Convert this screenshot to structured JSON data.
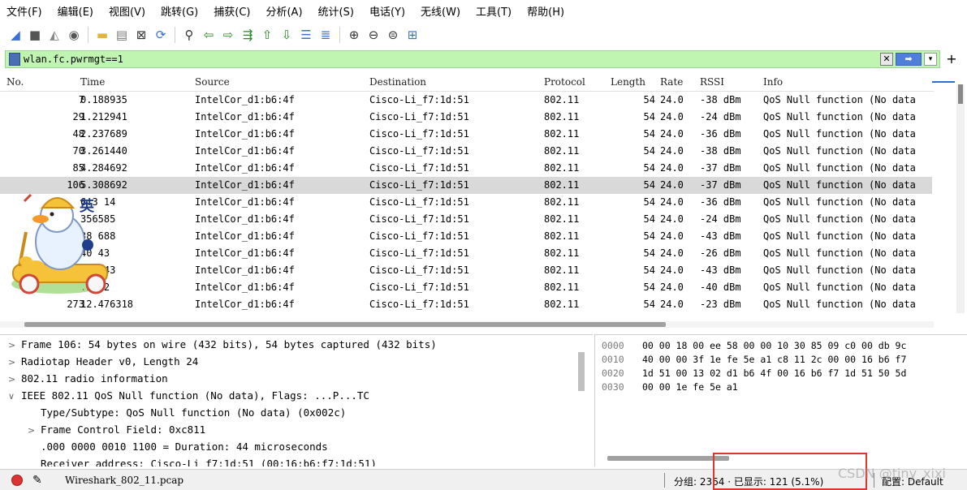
{
  "menu": [
    "文件(F)",
    "编辑(E)",
    "视图(V)",
    "跳转(G)",
    "捕获(C)",
    "分析(A)",
    "统计(S)",
    "电话(Y)",
    "无线(W)",
    "工具(T)",
    "帮助(H)"
  ],
  "toolbar_icons": [
    "shark-fin-start-icon",
    "stop-square-icon",
    "restart-fin-icon",
    "options-gear-icon",
    "open-folder-icon",
    "save-file-icon",
    "close-file-icon",
    "reload-icon",
    "find-magnifier-icon",
    "go-back-icon",
    "go-forward-icon",
    "go-to-packet-icon",
    "first-packet-icon",
    "last-packet-icon",
    "autoscroll-icon",
    "colorize-icon",
    "zoom-in-icon",
    "zoom-out-icon",
    "zoom-normal-icon",
    "resize-columns-icon"
  ],
  "filter": {
    "value": "wlan.fc.pwrmgt==1",
    "add_label": "+"
  },
  "columns": [
    "No.",
    "Time",
    "Source",
    "Destination",
    "Protocol",
    "Length",
    "Rate",
    "RSSI",
    "Info"
  ],
  "packets": [
    {
      "no": "7",
      "time": "0.188935",
      "src": "IntelCor_d1:b6:4f",
      "dst": "Cisco-Li_f7:1d:51",
      "proto": "802.11",
      "len": "54",
      "rate": "24.0",
      "rssi": "-38 dBm",
      "info": "QoS Null function (No data"
    },
    {
      "no": "29",
      "time": "1.212941",
      "src": "IntelCor_d1:b6:4f",
      "dst": "Cisco-Li_f7:1d:51",
      "proto": "802.11",
      "len": "54",
      "rate": "24.0",
      "rssi": "-24 dBm",
      "info": "QoS Null function (No data"
    },
    {
      "no": "48",
      "time": "2.237689",
      "src": "IntelCor_d1:b6:4f",
      "dst": "Cisco-Li_f7:1d:51",
      "proto": "802.11",
      "len": "54",
      "rate": "24.0",
      "rssi": "-36 dBm",
      "info": "QoS Null function (No data"
    },
    {
      "no": "70",
      "time": "3.261440",
      "src": "IntelCor_d1:b6:4f",
      "dst": "Cisco-Li_f7:1d:51",
      "proto": "802.11",
      "len": "54",
      "rate": "24.0",
      "rssi": "-38 dBm",
      "info": "QoS Null function (No data"
    },
    {
      "no": "85",
      "time": "4.284692",
      "src": "IntelCor_d1:b6:4f",
      "dst": "Cisco-Li_f7:1d:51",
      "proto": "802.11",
      "len": "54",
      "rate": "24.0",
      "rssi": "-37 dBm",
      "info": "QoS Null function (No data"
    },
    {
      "no": "106",
      "time": "5.308692",
      "src": "IntelCor_d1:b6:4f",
      "dst": "Cisco-Li_f7:1d:51",
      "proto": "802.11",
      "len": "54",
      "rate": "24.0",
      "rssi": "-37 dBm",
      "info": "QoS Null function (No data"
    },
    {
      "no": "",
      "time": "6.3  14",
      "src": "IntelCor_d1:b6:4f",
      "dst": "Cisco-Li_f7:1d:51",
      "proto": "802.11",
      "len": "54",
      "rate": "24.0",
      "rssi": "-36 dBm",
      "info": "QoS Null function (No data"
    },
    {
      "no": "",
      "time": "356585",
      "src": "IntelCor_d1:b6:4f",
      "dst": "Cisco-Li_f7:1d:51",
      "proto": "802.11",
      "len": "54",
      "rate": "24.0",
      "rssi": "-24 dBm",
      "info": "QoS Null function (No data"
    },
    {
      "no": "",
      "time": "38 688",
      "src": "IntelCor_d1:b6:4f",
      "dst": "Cisco-Li_f7:1d:51",
      "proto": "802.11",
      "len": "54",
      "rate": "24.0",
      "rssi": "-43 dBm",
      "info": "QoS Null function (No data"
    },
    {
      "no": "",
      "time": "40  43",
      "src": "IntelCor_d1:b6:4f",
      "dst": "Cisco-Li_f7:1d:51",
      "proto": "802.11",
      "len": "54",
      "rate": "24.0",
      "rssi": "-26 dBm",
      "info": "QoS Null function (No data"
    },
    {
      "no": "",
      "time": "428443",
      "src": "IntelCor_d1:b6:4f",
      "dst": "Cisco-Li_f7:1d:51",
      "proto": "802.11",
      "len": "54",
      "rate": "24.0",
      "rssi": "-43 dBm",
      "info": "QoS Null function (No data"
    },
    {
      "no": "",
      "time": ".2442",
      "src": "IntelCor_d1:b6:4f",
      "dst": "Cisco-Li_f7:1d:51",
      "proto": "802.11",
      "len": "54",
      "rate": "24.0",
      "rssi": "-40 dBm",
      "info": "QoS Null function (No data"
    },
    {
      "no": "273",
      "time": "12.476318",
      "src": "IntelCor_d1:b6:4f",
      "dst": "Cisco-Li_f7:1d:51",
      "proto": "802.11",
      "len": "54",
      "rate": "24.0",
      "rssi": "-23 dBm",
      "info": "QoS Null function (No data"
    }
  ],
  "selected_packet_no": "106",
  "mascot_char": "英",
  "details": [
    {
      "chev": ">",
      "text": "Frame 106: 54 bytes on wire (432 bits), 54 bytes captured (432 bits)"
    },
    {
      "chev": ">",
      "text": "Radiotap Header v0, Length 24"
    },
    {
      "chev": ">",
      "text": "802.11 radio information"
    },
    {
      "chev": "∨",
      "text": "IEEE 802.11 QoS Null function (No data), Flags: ...P...TC"
    },
    {
      "chev": "",
      "text": "Type/Subtype: QoS Null function (No data) (0x002c)"
    },
    {
      "chev": ">",
      "text": "Frame Control Field: 0xc811"
    },
    {
      "chev": "",
      "text": ".000 0000 0010 1100 = Duration: 44 microseconds"
    },
    {
      "chev": "",
      "text": "Receiver address: Cisco-Li_f7:1d:51 (00:16:b6:f7:1d:51)"
    }
  ],
  "bytes": [
    {
      "offset": "0000",
      "hex": "00 00 18 00 ee 58 00 00  10 30 85 09 c0 00 db 9c"
    },
    {
      "offset": "0010",
      "hex": "40 00 00 3f 1e fe 5e a1  c8 11 2c 00 00 16 b6 f7"
    },
    {
      "offset": "0020",
      "hex": "1d 51 00 13 02 d1 b6 4f  00 16 b6 f7 1d 51 50 5d"
    },
    {
      "offset": "0030",
      "hex": "00 00 1e fe 5e a1"
    }
  ],
  "status": {
    "file": "Wireshark_802_11.pcap",
    "stats": "分组: 2364 · 已显示: 121 (5.1%)",
    "profile": "配置: Default"
  },
  "watermark": "CSDN @tiny_xixi",
  "colors": {
    "filter_bg": "#bff5b1",
    "selected_row": "#d9d9d9",
    "highlight_box": "#e0342e"
  }
}
